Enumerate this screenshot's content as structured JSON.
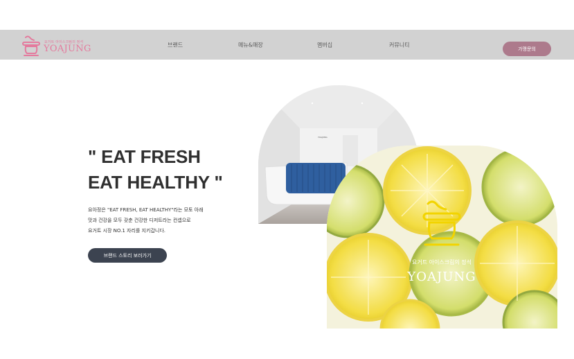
{
  "header": {
    "logo_tagline": "요거트 아이스크림의 정석",
    "logo_name": "YOAJUNG",
    "nav": [
      "브랜드",
      "메뉴&매장",
      "멤버십",
      "커뮤니티"
    ],
    "cta_label": "가맹문의"
  },
  "hero": {
    "title_line1": "\" EAT FRESH",
    "title_line2": "EAT HEALTHY \"",
    "desc": [
      "요아정은 \"EAT FRESH, EAT HEALTHY\"라는 모토 아래",
      "맛과 건강을 모두 갖춘 건강한 디저트라는 컨셉으로",
      "요거트 시장 NO.1 자리를 지키갑니다."
    ],
    "button_label": "브랜드 스토리 보러가기"
  },
  "images": {
    "lemon_tagline": "요거트 아이스크림의 정석",
    "lemon_brand": "YOAJUNG",
    "store_sign": "YOAJUNG"
  },
  "colors": {
    "brand_pink": "#e47a9d",
    "nav_bg": "#d2d2d2",
    "cta_bg": "#ad7a8c",
    "button_dark": "#3c4350",
    "counter_blue": "#2f5f9f"
  }
}
